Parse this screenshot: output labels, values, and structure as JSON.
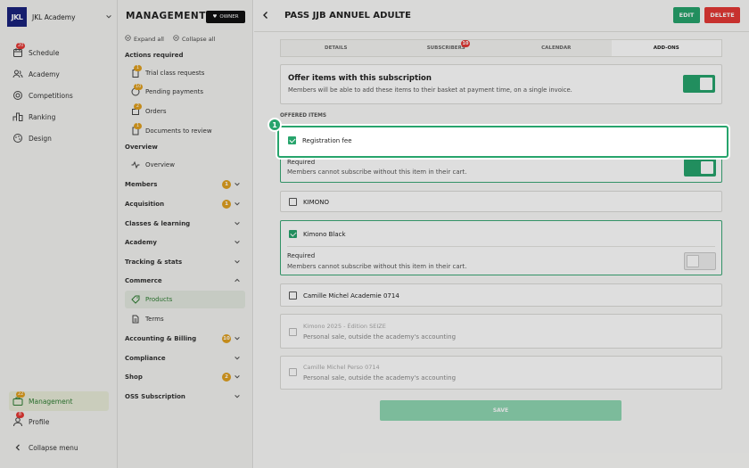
{
  "brand": {
    "logo": "JKL",
    "name": "JKL Academy"
  },
  "leftnav": {
    "items": [
      {
        "label": "Schedule",
        "badge": "20"
      },
      {
        "label": "Academy"
      },
      {
        "label": "Competitions"
      },
      {
        "label": "Ranking"
      },
      {
        "label": "Design"
      }
    ],
    "management": {
      "label": "Management",
      "badge": "22"
    },
    "profile": {
      "label": "Profile",
      "badge": "8"
    },
    "collapse": "Collapse menu"
  },
  "mgmt": {
    "title": "MANAGEMENT",
    "owner": "OWNER",
    "expand_all": "Expand all",
    "collapse_all": "Collapse all",
    "actions_required": "Actions required",
    "actions": [
      {
        "label": "Trial class requests",
        "badge": "1"
      },
      {
        "label": "Pending payments",
        "badge": "10"
      },
      {
        "label": "Orders",
        "badge": "2"
      },
      {
        "label": "Documents to review",
        "badge": "1"
      }
    ],
    "overview_section": "Overview",
    "overview_item": "Overview",
    "sections": [
      {
        "label": "Members",
        "badge": "1"
      },
      {
        "label": "Acquisition",
        "badge": "1"
      },
      {
        "label": "Classes & learning"
      },
      {
        "label": "Academy"
      },
      {
        "label": "Tracking & stats"
      },
      {
        "label": "Commerce"
      }
    ],
    "commerce_items": [
      "Products",
      "Terms"
    ],
    "sections2": [
      {
        "label": "Accounting & Billing",
        "badge": "10"
      },
      {
        "label": "Compliance"
      },
      {
        "label": "Shop",
        "badge": "2"
      },
      {
        "label": "OSS Subscription"
      }
    ]
  },
  "page": {
    "title": "PASS JJB ANNUEL ADULTE",
    "edit": "EDIT",
    "delete": "DELETE",
    "tabs": [
      {
        "label": "DETAILS"
      },
      {
        "label": "SUBSCRIBERS",
        "badge": "10"
      },
      {
        "label": "CALENDAR"
      },
      {
        "label": "ADD-ONS"
      }
    ],
    "offer": {
      "title": "Offer items with this subscription",
      "desc": "Members will be able to add these items to their basket at payment time, on a single invoice."
    },
    "offered_items_label": "OFFERED ITEMS",
    "required_label": "Required",
    "required_desc": "Members cannot subscribe without this item in their cart.",
    "items": [
      {
        "label": "Registration fee",
        "checked": true,
        "required": true
      },
      {
        "label": "KIMONO",
        "checked": false
      },
      {
        "label": "Kimono Black",
        "checked": true,
        "required": false
      },
      {
        "label": "Camille Michel Academie 0714",
        "checked": false
      },
      {
        "label": "Kimono 2025 - Édition SEIZE",
        "sub": "Personal sale, outside the academy's accounting",
        "disabled": true
      },
      {
        "label": "Camille Michel Perso 0714",
        "sub": "Personal sale, outside the academy's accounting",
        "disabled": true
      }
    ],
    "save": "SAVE",
    "step": "1"
  },
  "colors": {
    "accent": "#27a46c",
    "danger": "#e53935",
    "navy": "#1a237e",
    "warn": "#e0a020"
  }
}
